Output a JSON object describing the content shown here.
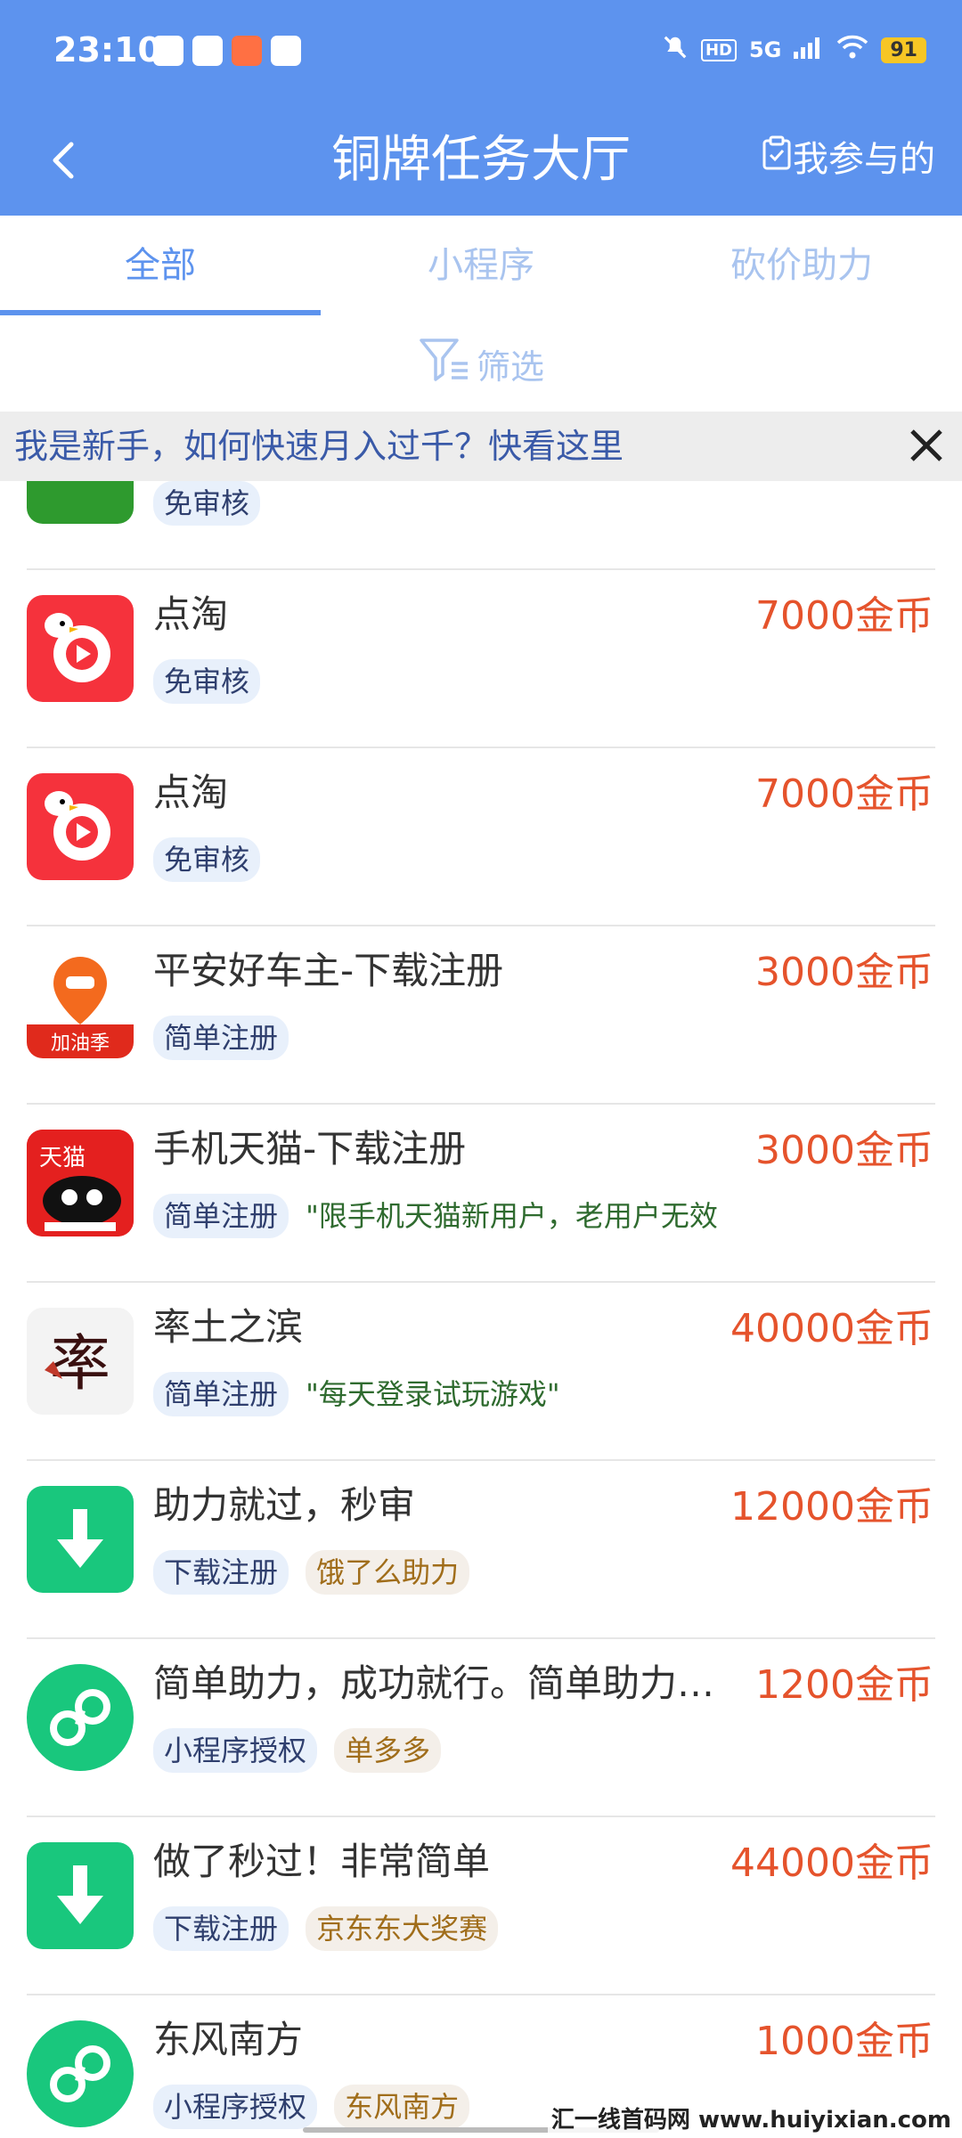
{
  "status_bar": {
    "time": "23:10",
    "network": "5G",
    "hd": "HD",
    "battery": "91",
    "notif_icons": [
      "app-notif-icon-blue",
      "message-notif-icon",
      "shopping-notif-icon",
      "home-notif-icon"
    ]
  },
  "header": {
    "title": "铜牌任务大厅",
    "my_participation": "我参与的",
    "accent_color": "#5d93ee"
  },
  "tabs": [
    {
      "label": "全部",
      "active": true
    },
    {
      "label": "小程序",
      "active": false
    },
    {
      "label": "砍价助力",
      "active": false
    }
  ],
  "filter": {
    "label": "筛选"
  },
  "notice": {
    "text": "我是新手，如何快速月入过千？快看这里"
  },
  "items": [
    {
      "name": "",
      "reward": "",
      "icon": "green-app-icon",
      "tags": [
        {
          "text": "免审核",
          "style": "blue"
        }
      ],
      "note": ""
    },
    {
      "name": "点淘",
      "reward": "7000金币",
      "icon": "diantao-app-icon",
      "tags": [
        {
          "text": "免审核",
          "style": "blue"
        }
      ],
      "note": ""
    },
    {
      "name": "点淘",
      "reward": "7000金币",
      "icon": "diantao-app-icon",
      "tags": [
        {
          "text": "免审核",
          "style": "blue"
        }
      ],
      "note": ""
    },
    {
      "name": "平安好车主-下载注册",
      "reward": "3000金币",
      "icon": "pingan-car-app-icon",
      "tags": [
        {
          "text": "简单注册",
          "style": "blue"
        }
      ],
      "note": ""
    },
    {
      "name": "手机天猫-下载注册",
      "reward": "3000金币",
      "icon": "tmall-app-icon",
      "tags": [
        {
          "text": "简单注册",
          "style": "blue"
        }
      ],
      "note": "\"限手机天猫新用户，老用户无效"
    },
    {
      "name": "率土之滨",
      "reward": "40000金币",
      "icon": "game-app-icon",
      "tags": [
        {
          "text": "简单注册",
          "style": "blue"
        }
      ],
      "note": "\"每天登录试玩游戏\""
    },
    {
      "name": "助力就过，秒审",
      "reward": "12000金币",
      "icon": "download-icon",
      "tags": [
        {
          "text": "下载注册",
          "style": "blue"
        },
        {
          "text": "饿了么助力",
          "style": "orange"
        }
      ],
      "note": ""
    },
    {
      "name": "简单助力，成功就行。简单助力，成功就行。",
      "reward": "1200金币",
      "icon": "mini-program-icon",
      "tags": [
        {
          "text": "小程序授权",
          "style": "blue"
        },
        {
          "text": "单多多",
          "style": "orange"
        }
      ],
      "note": ""
    },
    {
      "name": "做了秒过！非常简单",
      "reward": "44000金币",
      "icon": "download-icon",
      "tags": [
        {
          "text": "下载注册",
          "style": "blue"
        },
        {
          "text": "京东东大奖赛",
          "style": "orange"
        }
      ],
      "note": ""
    },
    {
      "name": "东风南方",
      "reward": "1000金币",
      "icon": "mini-program-icon",
      "tags": [
        {
          "text": "小程序授权",
          "style": "blue"
        },
        {
          "text": "东风南方",
          "style": "orange"
        }
      ],
      "note": ""
    }
  ],
  "watermark": "汇一线首码网 www.huiyixian.com"
}
